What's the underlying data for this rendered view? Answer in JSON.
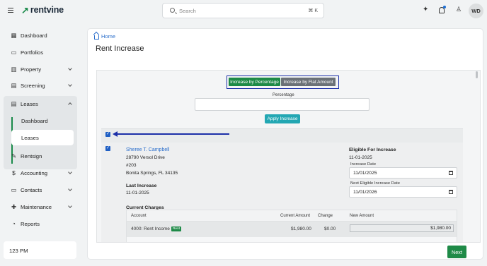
{
  "app": {
    "brand": "rentvine",
    "search_placeholder": "Search",
    "search_shortcut": "⌘ K",
    "user_initials": "WD"
  },
  "sidebar": {
    "items": [
      {
        "label": "Dashboard",
        "icon": "dashboard-icon"
      },
      {
        "label": "Portfolios",
        "icon": "portfolio-icon"
      },
      {
        "label": "Property",
        "icon": "property-icon",
        "expandable": true
      },
      {
        "label": "Screening",
        "icon": "screening-icon",
        "expandable": true
      },
      {
        "label": "Leases",
        "icon": "leases-icon",
        "expanded": true,
        "children": [
          {
            "label": "Dashboard"
          },
          {
            "label": "Leases",
            "active": true
          }
        ]
      },
      {
        "label": "Rentsign",
        "icon": "rentsign-icon"
      },
      {
        "label": "Accounting",
        "icon": "accounting-icon",
        "expandable": true
      },
      {
        "label": "Contacts",
        "icon": "contacts-icon",
        "expandable": true
      },
      {
        "label": "Maintenance",
        "icon": "maintenance-icon",
        "expandable": true
      },
      {
        "label": "Reports",
        "icon": "reports-icon"
      }
    ],
    "clock": "123 PM"
  },
  "main": {
    "breadcrumb": "Home",
    "title": "Rent Increase",
    "toggle": {
      "option_on": "Increase by Percentage",
      "option_off": "Increase by Flat Amount"
    },
    "percentage_label": "Percentage",
    "percentage_value": "",
    "apply_label": "Apply Increase",
    "select_all_checked": true,
    "lease": {
      "checked": true,
      "tenant": "Sheree T. Campbell",
      "address_line1": "28790 Versol Drive",
      "address_line2": "#203",
      "address_line3": "Bonita Springs, FL 34135",
      "last_increase_label": "Last Increase",
      "last_increase_date": "11-01-2025",
      "eligible_label": "Eligible For Increase",
      "eligible_date": "11-01-2025",
      "increase_date_label": "Increase Date",
      "increase_date_value": "11/01/2025",
      "next_eligible_label": "Next Eligible Increase Date",
      "next_eligible_value": "11/01/2026"
    },
    "charges": {
      "title": "Current Charges",
      "headers": {
        "account": "Account",
        "current_amount": "Current Amount",
        "change": "Change",
        "new_amount": "New Amount"
      },
      "rows": [
        {
          "account": "4000: Rent Income",
          "badge": "Rent",
          "current_amount": "$1,980.00",
          "change": "$0.00",
          "new_amount": "$1,980.00"
        }
      ]
    },
    "next_label": "Next"
  },
  "colors": {
    "brand_green": "#1e8a47",
    "link_blue": "#2a6ecb",
    "apply_teal": "#23a7b3",
    "annotation_blue": "#1c2fa8"
  }
}
